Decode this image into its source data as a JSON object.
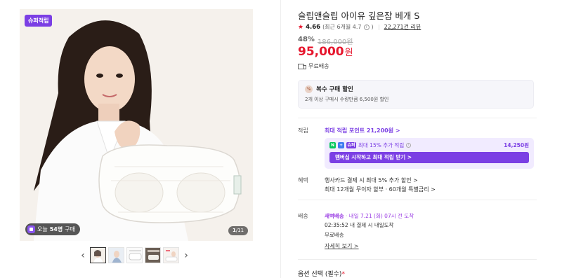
{
  "gallery": {
    "tag_label": "슈퍼적립",
    "buyers_prefix": "오늘",
    "buyers_count": "54명",
    "buyers_suffix": "구매",
    "counter_current": "1",
    "counter_total": "/11",
    "prev_icon": "chevron-left-icon",
    "next_icon": "chevron-right-icon",
    "thumbnail_count": 5
  },
  "product": {
    "title": "슬립앤슬립 아이유 깊은잠 베개 S",
    "rating": "4.66",
    "rating_sub": "(최근 6개월 4.7",
    "rating_sub_end": ")",
    "reviews": "22,271건 리뷰",
    "discount_pct": "48%",
    "original_price": "186,000원",
    "price": "95,000",
    "price_unit": "원",
    "shipping": "무료배송"
  },
  "multi_buy": {
    "icon_text": "%",
    "title": "복수 구매 할인",
    "desc": "2개 이상 구매시 수량만큼 6,500원 할인"
  },
  "points": {
    "label": "적립",
    "max_point": "최대 적립 포인트 21,200원 >",
    "member_badge_n": "N",
    "member_badge_plus": "+",
    "member_badge_tag": "슈퍼",
    "member_text": "최대 15% 추가 적립",
    "member_amount": "14,250원",
    "member_button": "멤버십 시작하고 최대 적립 받기 >"
  },
  "benefits": {
    "label": "혜택",
    "line1": "행사카드 결제 시 최대 5% 추가 할인 >",
    "line2": "최대 12개월 무이자 할부 · 60개월 특별금리 >"
  },
  "delivery": {
    "label": "배송",
    "tag": "새벽배송",
    "date": "내일 7.21 (화) 07시 전 도착",
    "timer": "02:35:52  내 결제 시 내일도착",
    "free": "무료배송",
    "more": "자세히 보기 >"
  },
  "option": {
    "label": "옵션 선택 (필수)",
    "required_mark": "*"
  },
  "colors": {
    "accent": "#7b3fe4",
    "price_red": "#e6162d",
    "naver_green": "#03c75a"
  }
}
